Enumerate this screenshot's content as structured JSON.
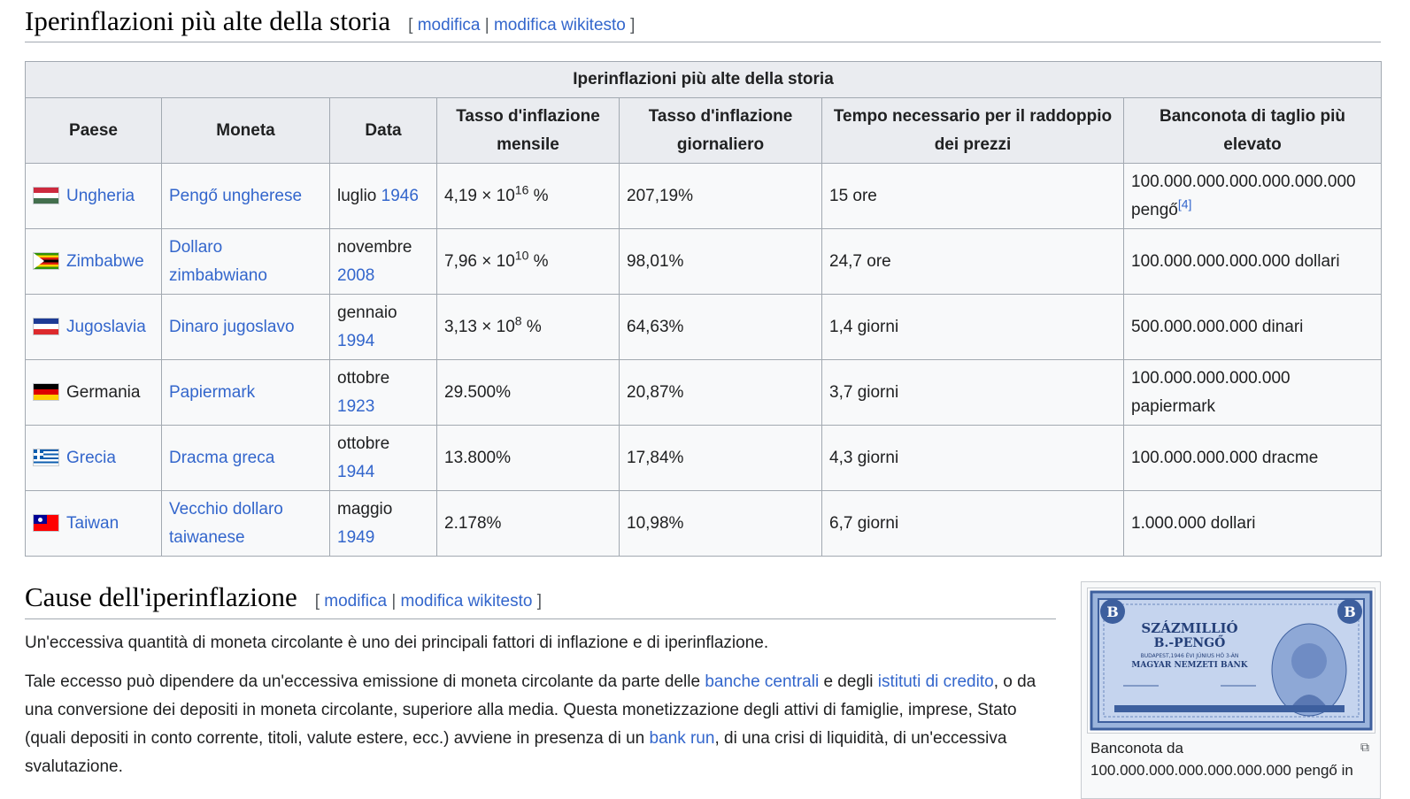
{
  "section1": {
    "title": "Iperinflazioni più alte della storia",
    "edit_open": "[",
    "edit_link": "modifica",
    "edit_sep": "|",
    "edit_wiki": "modifica wikitesto",
    "edit_close": "]"
  },
  "table": {
    "caption": "Iperinflazioni più alte della storia",
    "headers": [
      "Paese",
      "Moneta",
      "Data",
      "Tasso d'inflazione mensile",
      "Tasso d'inflazione giornaliero",
      "Tempo necessario per il raddoppio dei prezzi",
      "Banconota di taglio più elevato"
    ],
    "rows": [
      {
        "country": "Ungheria",
        "flag": "hungary-flag",
        "currency": "Pengő ungherese",
        "month": "luglio",
        "year": "1946",
        "monthly_base": "4,19 × 10",
        "monthly_exp": "16",
        "monthly_suffix": " %",
        "daily": "207,19%",
        "doubling": "15 ore",
        "banknote": "100.000.000.000.000.000.000 pengő",
        "note_ref": "[4]"
      },
      {
        "country": "Zimbabwe",
        "flag": "zimbabwe-flag",
        "currency": "Dollaro zimbabwiano",
        "month": "novembre",
        "year": "2008",
        "monthly_base": "7,96 × 10",
        "monthly_exp": "10",
        "monthly_suffix": " %",
        "daily": "98,01%",
        "doubling": "24,7 ore",
        "banknote": "100.000.000.000.000 dollari"
      },
      {
        "country": "Jugoslavia",
        "flag": "yugoslavia-flag",
        "currency": "Dinaro jugoslavo",
        "month": "gennaio",
        "year": "1994",
        "monthly_base": "3,13 × 10",
        "monthly_exp": "8",
        "monthly_suffix": " %",
        "daily": "64,63%",
        "doubling": "1,4 giorni",
        "banknote": "500.000.000.000 dinari"
      },
      {
        "country": "Germania",
        "flag": "germany-flag",
        "currency": "Papiermark",
        "month": "ottobre",
        "year": "1923",
        "monthly_plain": "29.500%",
        "daily": "20,87%",
        "doubling": "3,7 giorni",
        "banknote": "100.000.000.000.000 papiermark"
      },
      {
        "country": "Grecia",
        "flag": "greece-flag",
        "currency": "Dracma greca",
        "month": "ottobre",
        "year": "1944",
        "monthly_plain": "13.800%",
        "daily": "17,84%",
        "doubling": "4,3 giorni",
        "banknote": "100.000.000.000 dracme"
      },
      {
        "country": "Taiwan",
        "flag": "taiwan-flag",
        "currency": "Vecchio dollaro taiwanese",
        "month": "maggio",
        "year": "1949",
        "monthly_plain": "2.178%",
        "daily": "10,98%",
        "doubling": "6,7 giorni",
        "banknote": "1.000.000 dollari"
      }
    ]
  },
  "section2": {
    "title": "Cause dell'iperinflazione",
    "edit_open": "[",
    "edit_link": "modifica",
    "edit_sep": "|",
    "edit_wiki": "modifica wikitesto",
    "edit_close": "]"
  },
  "paragraphs": {
    "p1": "Un'eccessiva quantità di moneta circolante è uno dei principali fattori di inflazione e di iperinflazione.",
    "p2_a": "Tale eccesso può dipendere da un'eccessiva emissione di moneta circolante da parte delle ",
    "p2_link1": "banche centrali",
    "p2_b": " e degli ",
    "p2_link2": "istituti di credito",
    "p2_c": ", o da una conversione dei depositi in moneta circolante, superiore alla media. Questa monetizzazione degli attivi di famiglie, imprese, Stato (quali depositi in conto corrente, titoli, valute estere, ecc.) avviene in presenza di un ",
    "p2_link3": "bank run",
    "p2_d": ", di una crisi di liquidità, di un'eccessiva svalutazione."
  },
  "thumb": {
    "caption": "Banconota da 100.000.000.000.000.000.000 pengő in",
    "note_title": "SZÁZMILLIÓ",
    "note_sub": "B.-PENGŐ",
    "note_small": "BUDAPEST,1946 ÉVI JÚNIUS HÓ 3-ÁN",
    "note_bank": "MAGYAR NEMZETI BANK",
    "note_corner": "B"
  },
  "colors": {
    "link": "#3366cc",
    "header_bg": "#eaecf0",
    "cell_bg": "#f8f9fa",
    "border": "#a2a9b1",
    "note_blue": "#4a73b5"
  }
}
